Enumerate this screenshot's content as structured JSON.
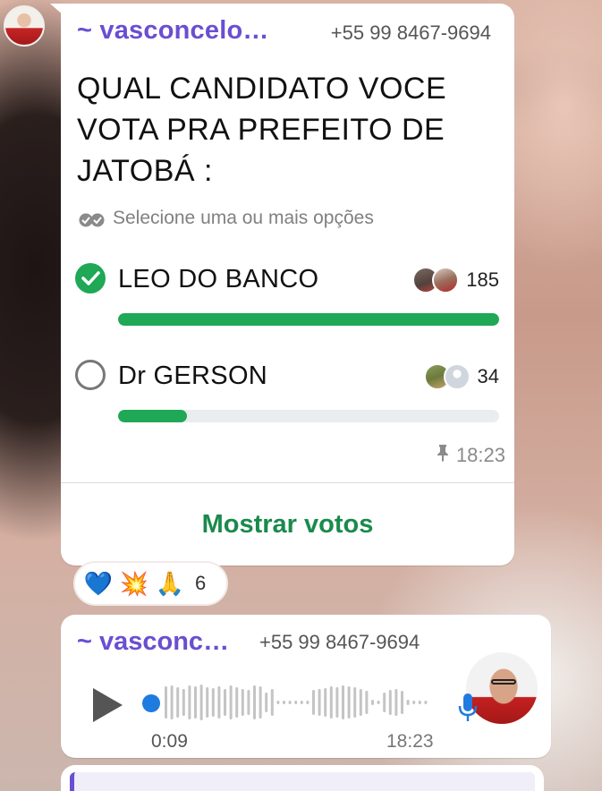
{
  "poll": {
    "sender": "~ vasconcelo…",
    "phone": "+55 99 8467-9694",
    "question": "QUAL CANDIDATO VOCE VOTA PRA PREFEITO DE JATOBÁ :",
    "hint": "Selecione uma ou mais opções",
    "options": [
      {
        "label": "LEO DO BANCO",
        "votes": "185",
        "checked": true,
        "fraction": 1.0
      },
      {
        "label": "Dr GERSON",
        "votes": "34",
        "checked": false,
        "fraction": 0.18
      }
    ],
    "time": "18:23",
    "show_votes_label": "Mostrar votos"
  },
  "reactions": {
    "emojis": [
      "💙",
      "💥",
      "🙏"
    ],
    "count": "6"
  },
  "audio": {
    "sender": "~ vasconc…",
    "phone": "+55 99 8467-9694",
    "duration": "0:09",
    "time": "18:23"
  },
  "colors": {
    "sender": "#6a4fd1",
    "accent_green": "#1fa855",
    "show_votes": "#1a8a4c",
    "scrub": "#1e7be0"
  }
}
